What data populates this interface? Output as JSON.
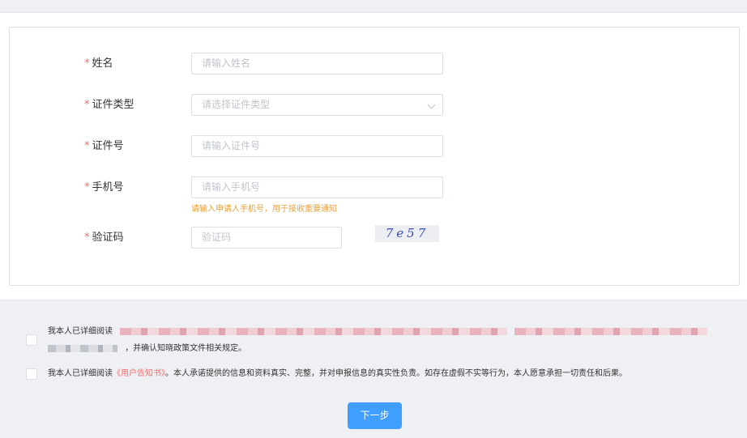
{
  "form": {
    "name": {
      "label": "姓名",
      "placeholder": "请输入姓名"
    },
    "id_type": {
      "label": "证件类型",
      "placeholder": "请选择证件类型"
    },
    "id_number": {
      "label": "证件号",
      "placeholder": "请输入证件号"
    },
    "phone": {
      "label": "手机号",
      "placeholder": "请输入手机号",
      "hint": "请输入申请人手机号，用于接收重要通知"
    },
    "captcha": {
      "label": "验证码",
      "placeholder": "验证码",
      "image_text": "7e57"
    },
    "required_mark": "*"
  },
  "agreements": {
    "first_prefix": "我本人已详细阅读",
    "first_suffix": "，并确认知晓政策文件相关规定。",
    "second_prefix": "我本人已详细阅读",
    "second_link": "《用户告知书》",
    "second_suffix": "。本人承诺提供的信息和资料真实、完整，并对申报信息的真实性负责。如存在虚假不实等行为，本人愿意承担一切责任和后果。"
  },
  "actions": {
    "next_label": "下一步"
  },
  "colors": {
    "primary": "#409eff",
    "required": "#f56c6c",
    "hint": "#e6a23c",
    "background": "#eef0f4"
  },
  "icons": {
    "select": "chevron-down-icon"
  }
}
